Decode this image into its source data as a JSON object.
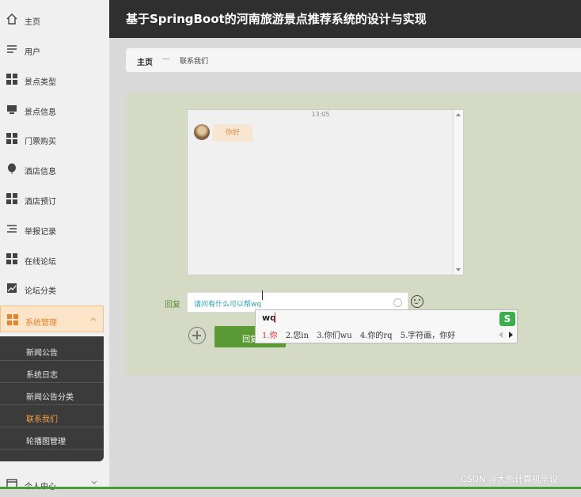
{
  "header": {
    "title": "基于SpringBoot的河南旅游景点推荐系统的设计与实现"
  },
  "sidebar": {
    "items": [
      {
        "label": "主页",
        "icon": "home-icon"
      },
      {
        "label": "用户",
        "icon": "list-icon"
      },
      {
        "label": "景点类型",
        "icon": "grid-icon"
      },
      {
        "label": "景点信息",
        "icon": "monitor-icon"
      },
      {
        "label": "门票购买",
        "icon": "grid-icon"
      },
      {
        "label": "酒店信息",
        "icon": "balloon-icon"
      },
      {
        "label": "酒店预订",
        "icon": "grid-icon"
      },
      {
        "label": "举报记录",
        "icon": "list-icon"
      },
      {
        "label": "在线论坛",
        "icon": "grid-icon"
      },
      {
        "label": "论坛分类",
        "icon": "chart-icon"
      },
      {
        "label": "系统管理",
        "icon": "grid-icon",
        "active": true
      }
    ],
    "submenu": [
      {
        "label": "新闻公告"
      },
      {
        "label": "系统日志"
      },
      {
        "label": "新闻公告分类"
      },
      {
        "label": "联系我们",
        "active": true
      },
      {
        "label": "轮播图管理"
      }
    ],
    "personal": {
      "label": "个人中心"
    }
  },
  "breadcrumb": {
    "home": "主页",
    "separator": "—",
    "current": "联系我们"
  },
  "chat": {
    "time": "13:05",
    "message": "你好"
  },
  "reply": {
    "label": "回复",
    "value": "请问有什么可以帮wq",
    "send_label": "回复"
  },
  "ime": {
    "pinyin": "wq",
    "candidates": [
      "1.你",
      "2.您in",
      "3.你们wu",
      "4.你的rq",
      "5.字符画，你好"
    ],
    "logo": "S"
  },
  "watermark": "CSDN @大熊计算机毕设",
  "colors": {
    "accent": "#e8832a",
    "send": "#5a9a35",
    "header": "#2f2f2f"
  }
}
